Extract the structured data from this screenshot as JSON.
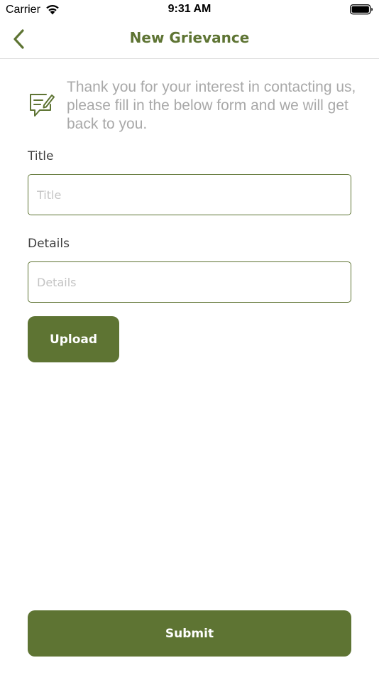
{
  "status_bar": {
    "carrier": "Carrier",
    "time": "9:31 AM",
    "icons": [
      "wifi-icon",
      "battery-icon"
    ]
  },
  "nav": {
    "title": "New Grievance",
    "back_icon": "chevron-left-icon"
  },
  "intro": {
    "icon": "message-edit-icon",
    "text": "Thank you for your interest in contacting us, please fill in the below form and we will get back to you."
  },
  "form": {
    "title_label": "Title",
    "title_value": "",
    "title_placeholder": "Title",
    "details_label": "Details",
    "details_value": "",
    "details_placeholder": "Details",
    "upload_label": "Upload",
    "submit_label": "Submit"
  },
  "colors": {
    "accent": "#5e7433",
    "placeholder": "#c4c4c4",
    "intro_text": "#a9a9a9",
    "label_text": "#3f3f3f"
  }
}
